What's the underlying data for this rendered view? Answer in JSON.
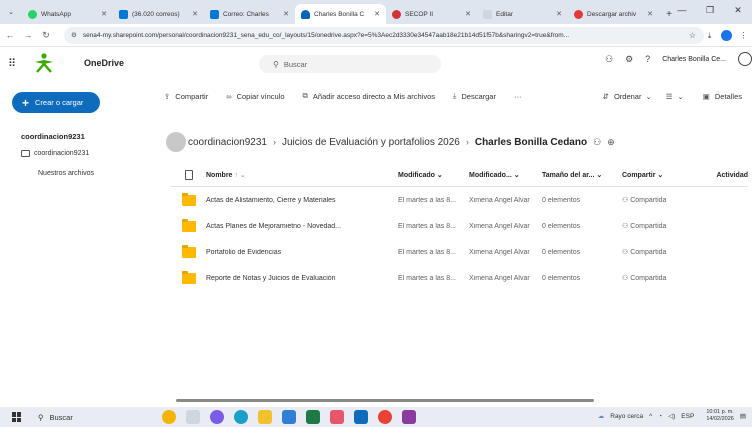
{
  "browser": {
    "tabs": [
      {
        "title": "WhatsApp",
        "color": "#25d366",
        "active": false
      },
      {
        "title": "(36.020 correos)",
        "color": "#0078d4",
        "active": false
      },
      {
        "title": "Correo: Charles",
        "color": "#0078d4",
        "active": false
      },
      {
        "title": "Charles Bonilla C",
        "color": "#0364b8",
        "active": true
      },
      {
        "title": "SECOP II",
        "color": "#d13438",
        "active": false
      },
      {
        "title": "Editar",
        "color": "#cfd6e0",
        "active": false
      },
      {
        "title": "Descargar archiv",
        "color": "#e23a3a",
        "active": false
      }
    ],
    "new_tab": "+",
    "url": "sena4-my.sharepoint.com/personal/coordinacion9231_sena_edu_co/_layouts/15/onedrive.aspx?e=5%3Aec2d3330e34547aab18e21b14d51f57b&sharingv2=true&from..."
  },
  "suite": {
    "app_name": "OneDrive",
    "search_placeholder": "Buscar",
    "account_name": "Charles Bonilla Ce..."
  },
  "sidebar": {
    "create_label": "Crear o cargar",
    "user": "coordinacion9231",
    "folder": "coordinacion9231",
    "files": "Nuestros archivos"
  },
  "commands": {
    "share": "Compartir",
    "copy_link": "Copiar vínculo",
    "add_shortcut": "Añadir acceso directo a Mis archivos",
    "download": "Descargar",
    "more": "···",
    "sort": "Ordenar",
    "details": "Detalles"
  },
  "breadcrumb": {
    "root": "coordinacion9231",
    "parent": "Juicios de Evaluación y portafolios 2026",
    "current": "Charles Bonilla Cedano"
  },
  "table": {
    "headers": {
      "name": "Nombre",
      "name_sort": "↑ ⌄",
      "modified": "Modificado ⌄",
      "modified_by": "Modificado... ⌄",
      "size": "Tamaño del ar... ⌄",
      "sharing": "Compartir ⌄",
      "activity": "Actividad"
    },
    "rows": [
      {
        "name": "Actas de Alistamiento, Cierre y Materiales",
        "modified": "El martes a las 8...",
        "modified_by": "Ximena Angel Alvar",
        "size": "0 elementos",
        "sharing": "Compartida"
      },
      {
        "name": "Actas Planes de Mejoramietno - Novedad...",
        "modified": "El martes a las 8...",
        "modified_by": "Ximena Angel Alvar",
        "size": "0 elementos",
        "sharing": "Compartida"
      },
      {
        "name": "Portafolio de Evidencias",
        "modified": "El martes a las 8...",
        "modified_by": "Ximena Angel Alvar",
        "size": "0 elementos",
        "sharing": "Compartida"
      },
      {
        "name": "Reporte de Notas y Juicios de Evaluación",
        "modified": "El martes a las 8...",
        "modified_by": "Ximena Angel Alvar",
        "size": "0 elementos",
        "sharing": "Compartida"
      }
    ]
  },
  "taskbar": {
    "search": "Buscar",
    "weather": "Rayo cerca",
    "lang": "ESP",
    "time": "10:01 p. m.",
    "date": "14/02/2026"
  },
  "colors": {
    "accent": "#0f6cbd",
    "folder": "#ffb900"
  }
}
